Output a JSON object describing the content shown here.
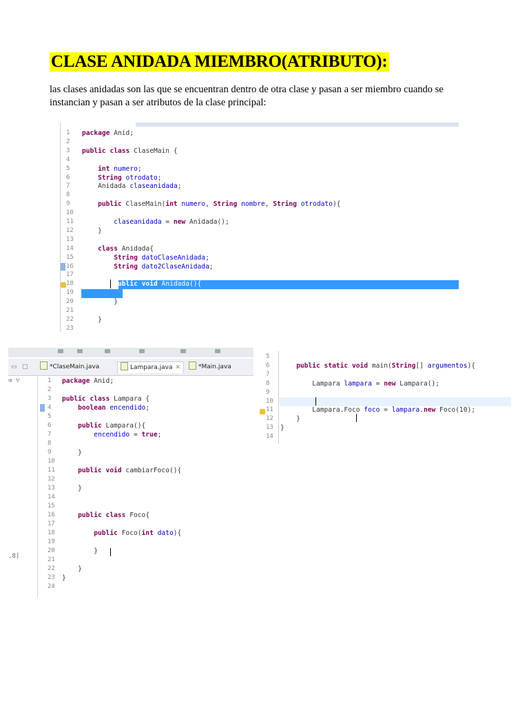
{
  "doc": {
    "title": "CLASE ANIDADA MIEMBRO(ATRIBUTO):",
    "paragraph": "las clases anidadas son las que se encuentran dentro de otra clase y pasan a ser miembro cuando se instancian y pasan a ser atributos de la clase principal:"
  },
  "colors": {
    "highlight": "#ffff00",
    "selection": "#3399ff",
    "keyword": "#7f0055",
    "field": "#0000c0"
  },
  "shot1": {
    "lines": [
      {
        "n": "1",
        "code": "package Anid;"
      },
      {
        "n": "2",
        "code": ""
      },
      {
        "n": "3",
        "code": "public class ClaseMain {"
      },
      {
        "n": "4",
        "code": ""
      },
      {
        "n": "5",
        "code": "    int numero;"
      },
      {
        "n": "6",
        "code": "    String otrodato;"
      },
      {
        "n": "7",
        "code": "    Anidada claseanidada;"
      },
      {
        "n": "8",
        "code": ""
      },
      {
        "n": "9",
        "code": "    public ClaseMain(int numero, String nombre, String otrodato){"
      },
      {
        "n": "10",
        "code": ""
      },
      {
        "n": "11",
        "code": "        claseanidada = new Anidada();"
      },
      {
        "n": "12",
        "code": "    }"
      },
      {
        "n": "13",
        "code": ""
      },
      {
        "n": "14",
        "code": "    class Anidada{"
      },
      {
        "n": "15",
        "code": "        String datoClaseAnidada;"
      },
      {
        "n": "16",
        "code": "        String dato2ClaseAnidada;"
      },
      {
        "n": "17",
        "code": ""
      },
      {
        "n": "18",
        "code": "        public void Anidada(){"
      },
      {
        "n": "19",
        "code": ""
      },
      {
        "n": "20",
        "code": "        }"
      },
      {
        "n": "21",
        "code": ""
      },
      {
        "n": "22",
        "code": "    }"
      },
      {
        "n": "23",
        "code": ""
      }
    ]
  },
  "shot2": {
    "tabs": [
      "*ClaseMain.java",
      "Lampara.java",
      "*Main.java"
    ],
    "side_label": ".8]",
    "lines": [
      {
        "n": "1",
        "code": "package Anid;"
      },
      {
        "n": "2",
        "code": ""
      },
      {
        "n": "3",
        "code": "public class Lampara {"
      },
      {
        "n": "4",
        "code": "    boolean encendido;"
      },
      {
        "n": "5",
        "code": ""
      },
      {
        "n": "6",
        "code": "    public Lampara(){"
      },
      {
        "n": "7",
        "code": "        encendido = true;"
      },
      {
        "n": "8",
        "code": ""
      },
      {
        "n": "9",
        "code": "    }"
      },
      {
        "n": "10",
        "code": ""
      },
      {
        "n": "11",
        "code": "    public void cambiarFoco(){"
      },
      {
        "n": "12",
        "code": ""
      },
      {
        "n": "13",
        "code": "    }"
      },
      {
        "n": "14",
        "code": ""
      },
      {
        "n": "15",
        "code": ""
      },
      {
        "n": "16",
        "code": "    public class Foco{"
      },
      {
        "n": "17",
        "code": ""
      },
      {
        "n": "18",
        "code": "        public Foco(int dato){"
      },
      {
        "n": "19",
        "code": ""
      },
      {
        "n": "20",
        "code": "        }"
      },
      {
        "n": "21",
        "code": ""
      },
      {
        "n": "22",
        "code": "    }"
      },
      {
        "n": "23",
        "code": "}"
      },
      {
        "n": "24",
        "code": ""
      }
    ]
  },
  "shot3": {
    "lines": [
      {
        "n": "5",
        "code": ""
      },
      {
        "n": "6",
        "code": "    public static void main(String[] argumentos){"
      },
      {
        "n": "7",
        "code": ""
      },
      {
        "n": "8",
        "code": "        Lampara lampara = new Lampara();"
      },
      {
        "n": "9",
        "code": ""
      },
      {
        "n": "10",
        "code": ""
      },
      {
        "n": "11",
        "code": "        Lampara.Foco foco = lampara.new Foco(10);"
      },
      {
        "n": "12",
        "code": "    }"
      },
      {
        "n": "13",
        "code": "}"
      },
      {
        "n": "14",
        "code": ""
      }
    ]
  }
}
